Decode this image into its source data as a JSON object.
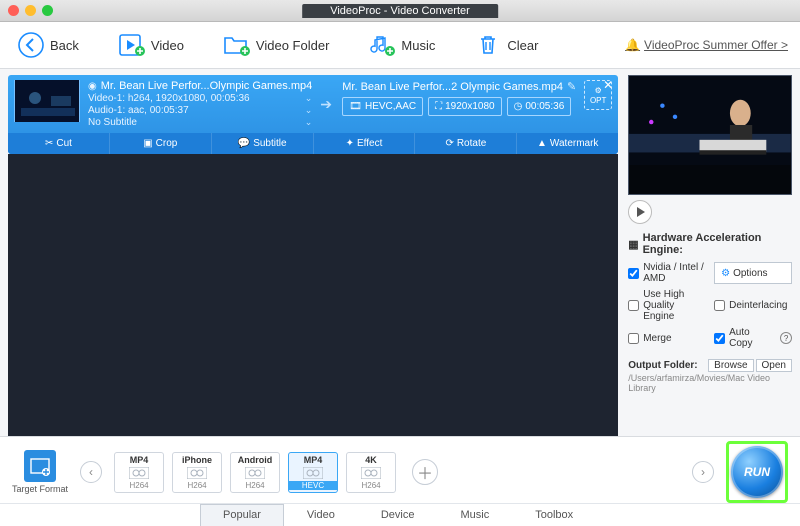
{
  "window": {
    "title": "VideoProc - Video Converter"
  },
  "toolbar": {
    "back": "Back",
    "video": "Video",
    "video_folder": "Video Folder",
    "music": "Music",
    "clear": "Clear",
    "offer": "VideoProc Summer Offer >"
  },
  "clip": {
    "input_name": "Mr. Bean Live Perfor...Olympic Games.mp4",
    "video_info": "Video-1: h264, 1920x1080, 00:05:36",
    "audio_info": "Audio-1: aac, 00:05:37",
    "subtitle_info": "No Subtitle",
    "output_name": "Mr. Bean Live Perfor...2 Olympic Games.mp4",
    "codec": "HEVC,AAC",
    "resolution": "1920x1080",
    "duration": "00:05:36",
    "opt_label": "OPT",
    "tools": {
      "cut": "Cut",
      "crop": "Crop",
      "subtitle": "Subtitle",
      "effect": "Effect",
      "rotate": "Rotate",
      "watermark": "Watermark"
    }
  },
  "right": {
    "hwa": "Hardware Acceleration Engine:",
    "nvidia": "Nvidia / Intel / AMD",
    "options": "Options",
    "hq": "Use High Quality Engine",
    "deint": "Deinterlacing",
    "merge": "Merge",
    "autocopy": "Auto Copy",
    "output_folder_label": "Output Folder:",
    "browse": "Browse",
    "open": "Open",
    "output_path": "/Users/arfamirza/Movies/Mac Video Library"
  },
  "bottom": {
    "target_format": "Target Format",
    "presets": [
      {
        "top": "MP4",
        "codec": "H264"
      },
      {
        "top": "iPhone",
        "codec": "H264"
      },
      {
        "top": "Android",
        "codec": "H264"
      },
      {
        "top": "MP4",
        "codec": "HEVC",
        "selected": true
      },
      {
        "top": "4K",
        "codec": "H264"
      }
    ],
    "tabs": [
      "Popular",
      "Video",
      "Device",
      "Music",
      "Toolbox"
    ],
    "selected_tab": "Popular",
    "run": "RUN"
  }
}
